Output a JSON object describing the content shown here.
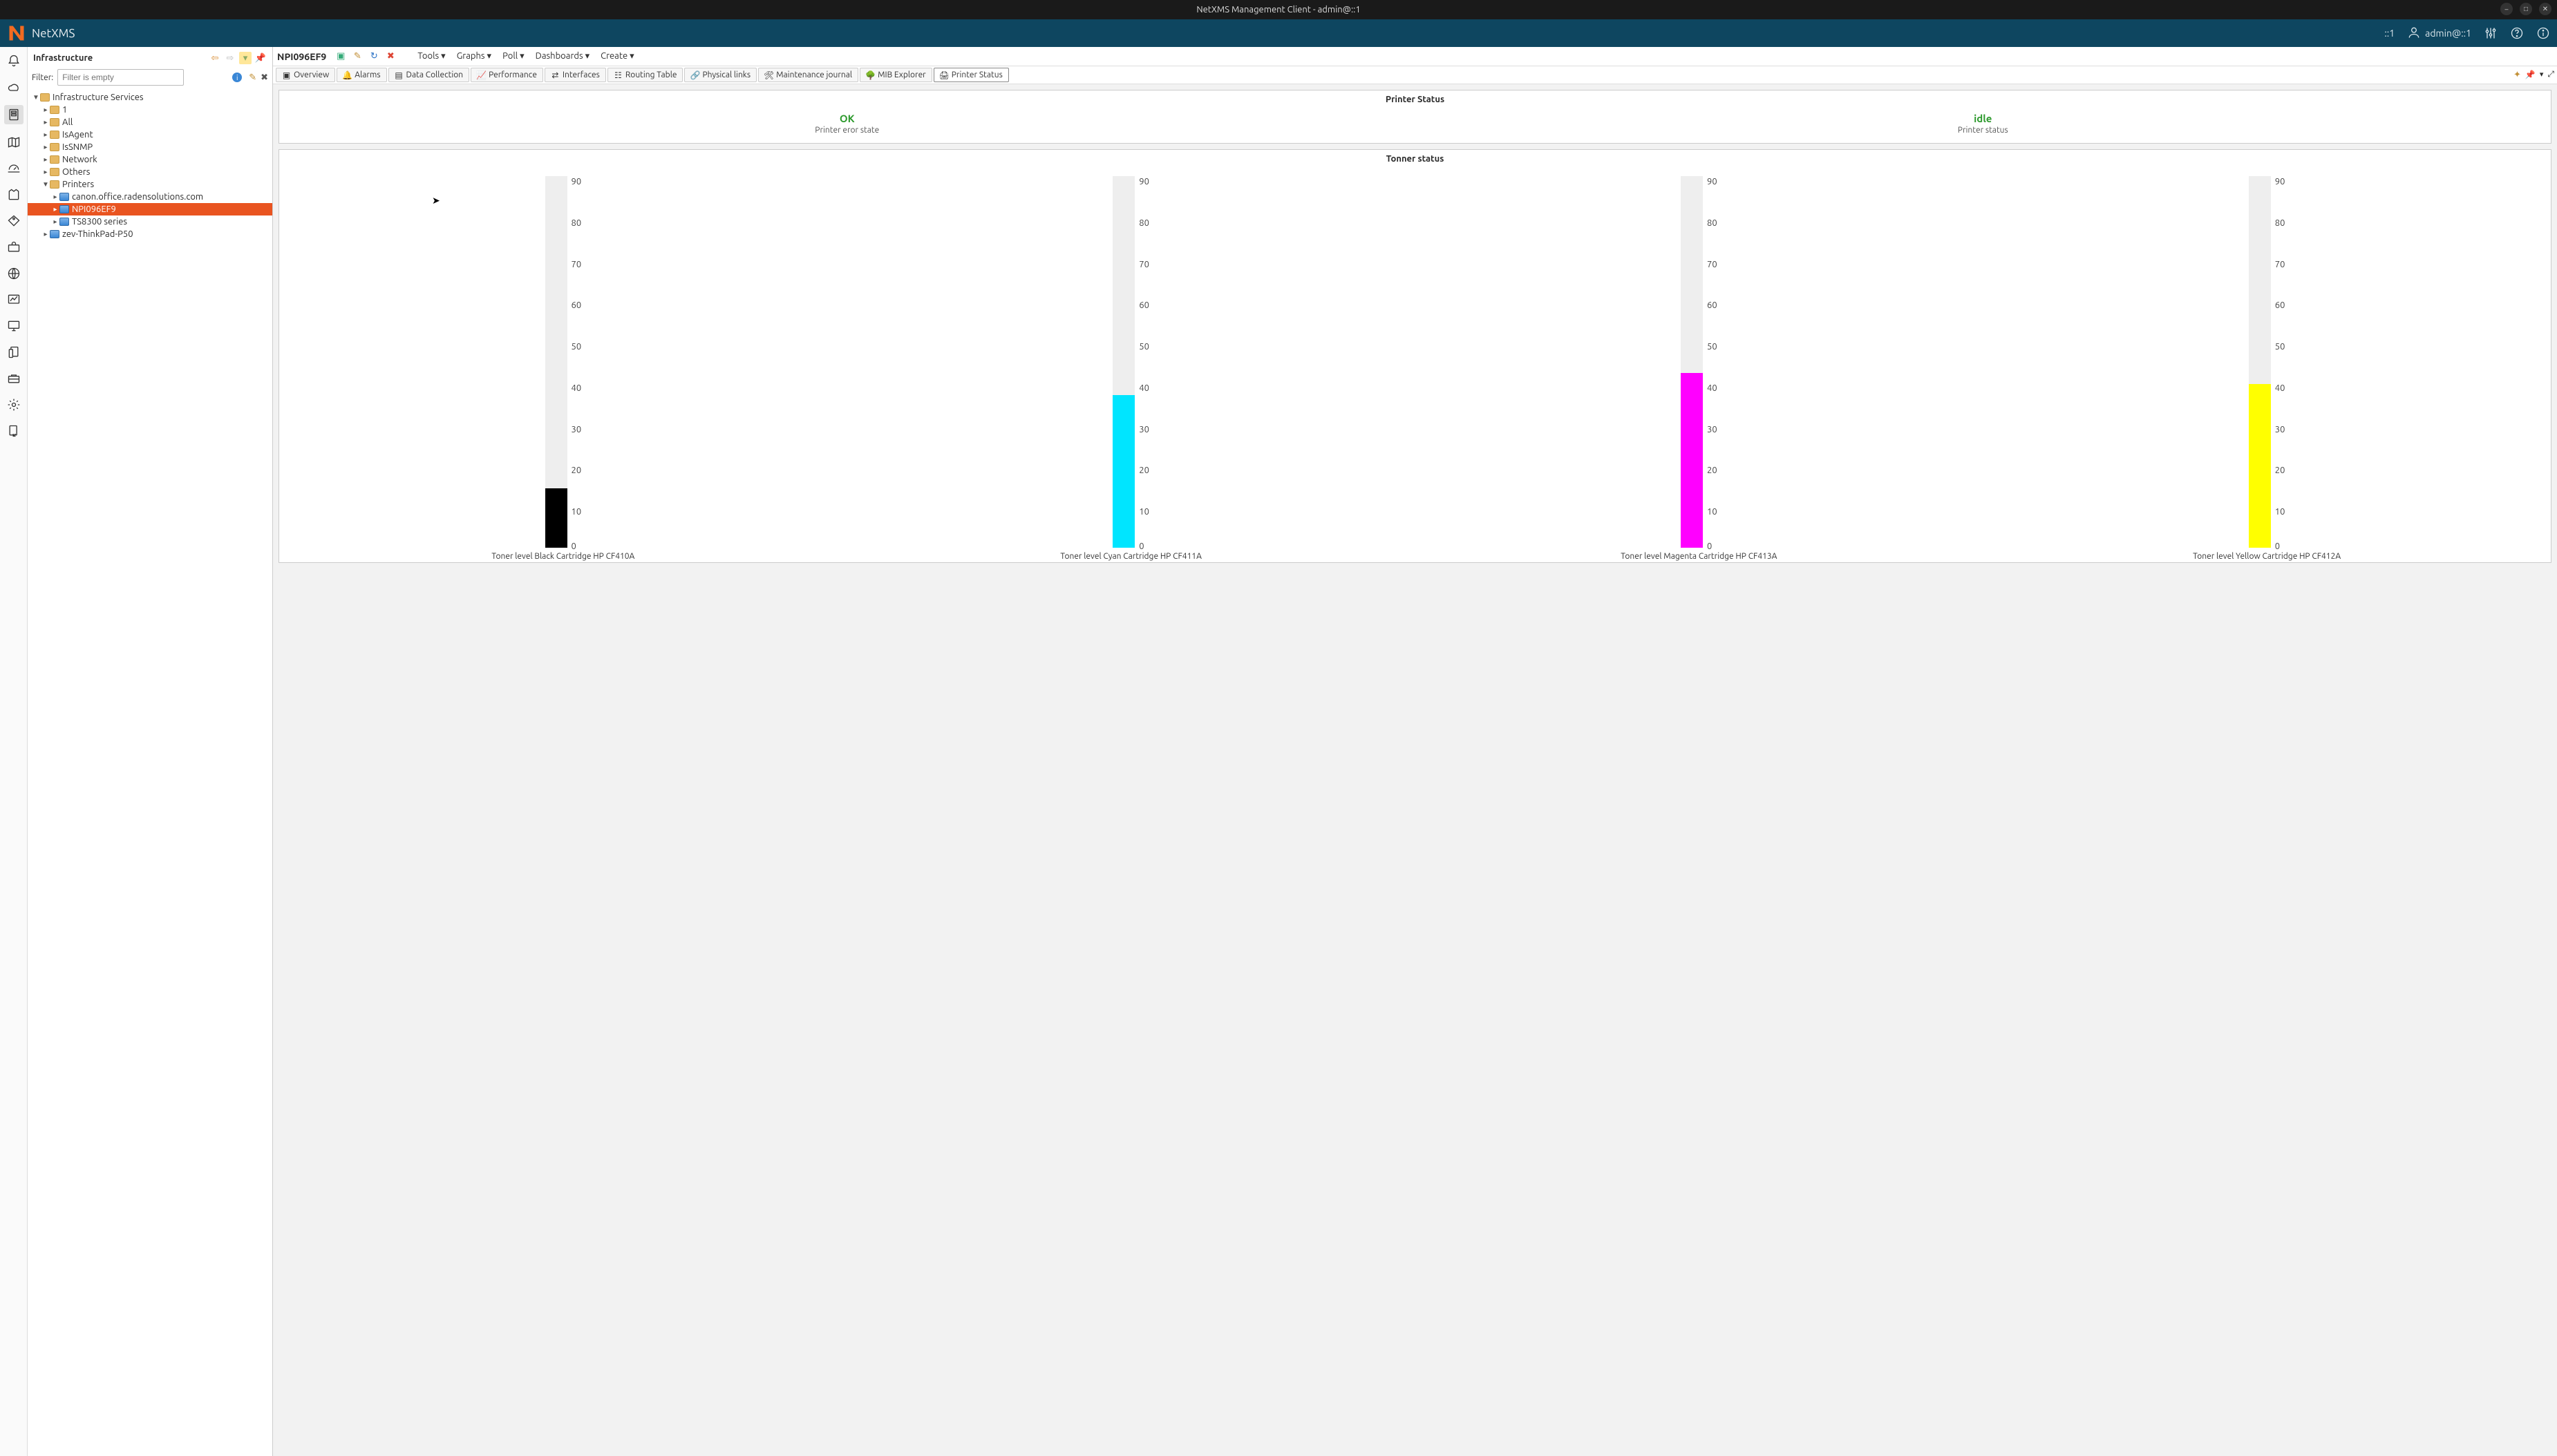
{
  "window": {
    "title": "NetXMS Management Client - admin@::1"
  },
  "header": {
    "brand": "NetXMS",
    "server": "::1",
    "user": "admin@::1"
  },
  "sidebar": {
    "title": "Infrastructure",
    "filter_label": "Filter:",
    "filter_placeholder": "Filter is empty",
    "tree": {
      "root": "Infrastructure Services",
      "items": [
        {
          "label": "1"
        },
        {
          "label": "All"
        },
        {
          "label": "IsAgent"
        },
        {
          "label": "IsSNMP"
        },
        {
          "label": "Network"
        },
        {
          "label": "Others"
        },
        {
          "label": "Printers",
          "expanded": true,
          "children": [
            {
              "label": "canon.office.radensolutions.com",
              "node": true
            },
            {
              "label": "NPI096EF9",
              "node": true,
              "selected": true
            },
            {
              "label": "TS8300 series",
              "node": true
            }
          ]
        },
        {
          "label": "zev-ThinkPad-P50",
          "node": true
        }
      ]
    }
  },
  "object": {
    "title": "NPI096EF9",
    "menus": [
      "Tools ▾",
      "Graphs ▾",
      "Poll ▾",
      "Dashboards ▾",
      "Create ▾"
    ],
    "tabs": [
      {
        "label": "Overview"
      },
      {
        "label": "Alarms"
      },
      {
        "label": "Data Collection"
      },
      {
        "label": "Performance"
      },
      {
        "label": "Interfaces"
      },
      {
        "label": "Routing Table"
      },
      {
        "label": "Physical links"
      },
      {
        "label": "Maintenance journal"
      },
      {
        "label": "MIB Explorer"
      },
      {
        "label": "Printer Status",
        "active": true
      }
    ]
  },
  "printer_status": {
    "title": "Printer Status",
    "cells": [
      {
        "value": "OK",
        "sub": "Printer eror state"
      },
      {
        "value": "idle",
        "sub": "Printer status"
      }
    ]
  },
  "toner_status": {
    "title": "Tonner status"
  },
  "chart_data": {
    "type": "bar",
    "ylim": [
      0,
      100
    ],
    "ticks": [
      90,
      80,
      70,
      60,
      50,
      40,
      30,
      20,
      10,
      0
    ],
    "series": [
      {
        "name": "Toner level Black Cartridge HP CF410A",
        "value": 16,
        "color": "#000000"
      },
      {
        "name": "Toner level Cyan Cartridge HP CF411A",
        "value": 41,
        "color": "#00e5ff"
      },
      {
        "name": "Toner level Magenta Cartridge HP CF413A",
        "value": 47,
        "color": "#ff00ff"
      },
      {
        "name": "Toner level Yellow Cartridge HP CF412A",
        "value": 44,
        "color": "#ffff00"
      }
    ]
  }
}
